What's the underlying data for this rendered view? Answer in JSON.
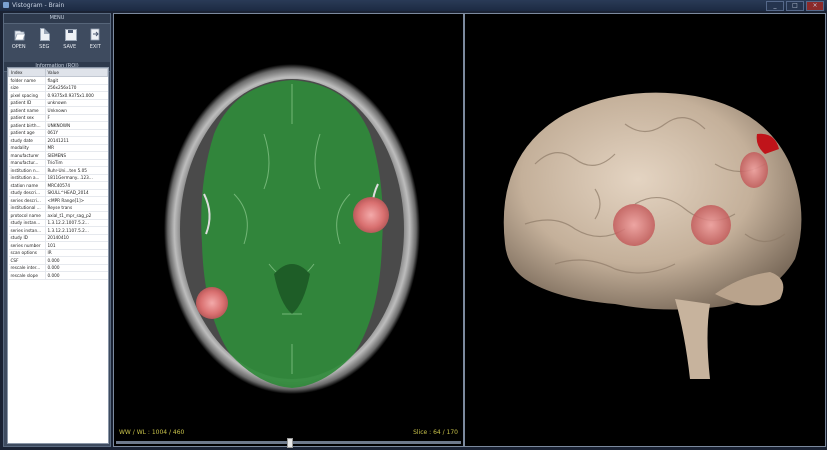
{
  "window": {
    "title": "Vistogram - Brain",
    "buttons": [
      "_",
      "□",
      "×"
    ]
  },
  "left_panel": {
    "menu_header": "MENU",
    "tools": [
      {
        "icon": "open-file-icon",
        "label": "OPEN"
      },
      {
        "icon": "document-icon",
        "label": "SEG"
      },
      {
        "icon": "save-disk-icon",
        "label": "SAVE"
      },
      {
        "icon": "exit-icon",
        "label": "EXIT"
      }
    ],
    "info_header": "Information (ROI)",
    "table": {
      "columns": [
        "Index",
        "Value"
      ],
      "rows": [
        [
          "folder name",
          "flagit"
        ],
        [
          "size",
          "256x256x170"
        ],
        [
          "pixel spacing",
          "0.9375x0.9375x1.000"
        ],
        [
          "patient ID",
          "unknown"
        ],
        [
          "patient name",
          "Unknown"
        ],
        [
          "patient sex",
          "F"
        ],
        [
          "patient birth...",
          "UNKNOWN"
        ],
        [
          "patient age",
          "061Y"
        ],
        [
          "study date",
          "20141211"
        ],
        [
          "modality",
          "MR"
        ],
        [
          "manufacturer",
          "SIEMENS"
        ],
        [
          "manufactur...",
          "TrioTim"
        ],
        [
          "institution n...",
          "Ruhr-Uni...ten 5.05"
        ],
        [
          "institution a...",
          "1811Germany...123..."
        ],
        [
          "station name",
          "MRC40574"
        ],
        [
          "study descri...",
          "SKULL^HEAD_2014"
        ],
        [
          "series descri...",
          "<MPR Range[1]>"
        ],
        [
          "institutional ...",
          "Reyse trans"
        ],
        [
          "protocol name",
          "axial_t1_mpr_sag_p2"
        ],
        [
          "study instan...",
          "1.3.12.2.1007.5.2..."
        ],
        [
          "series instan...",
          "1.3.12.2.1107.5.2..."
        ],
        [
          "study ID",
          "20140410"
        ],
        [
          "series number",
          "101"
        ],
        [
          "scan options",
          "IR"
        ],
        [
          "CSF",
          "0.000"
        ],
        [
          "rescale inter...",
          "0.000"
        ],
        [
          "rescale slope",
          "0.000"
        ]
      ]
    }
  },
  "axial_view": {
    "ww_wl": "WW / WL : 1004 / 460",
    "slice": "Slice : 64 / 170",
    "slider_percent": 50
  },
  "colors": {
    "brain_overlay": "#2f8a3a",
    "tumor": "#e07a7a",
    "panel_bg": "#3e4b5f"
  }
}
